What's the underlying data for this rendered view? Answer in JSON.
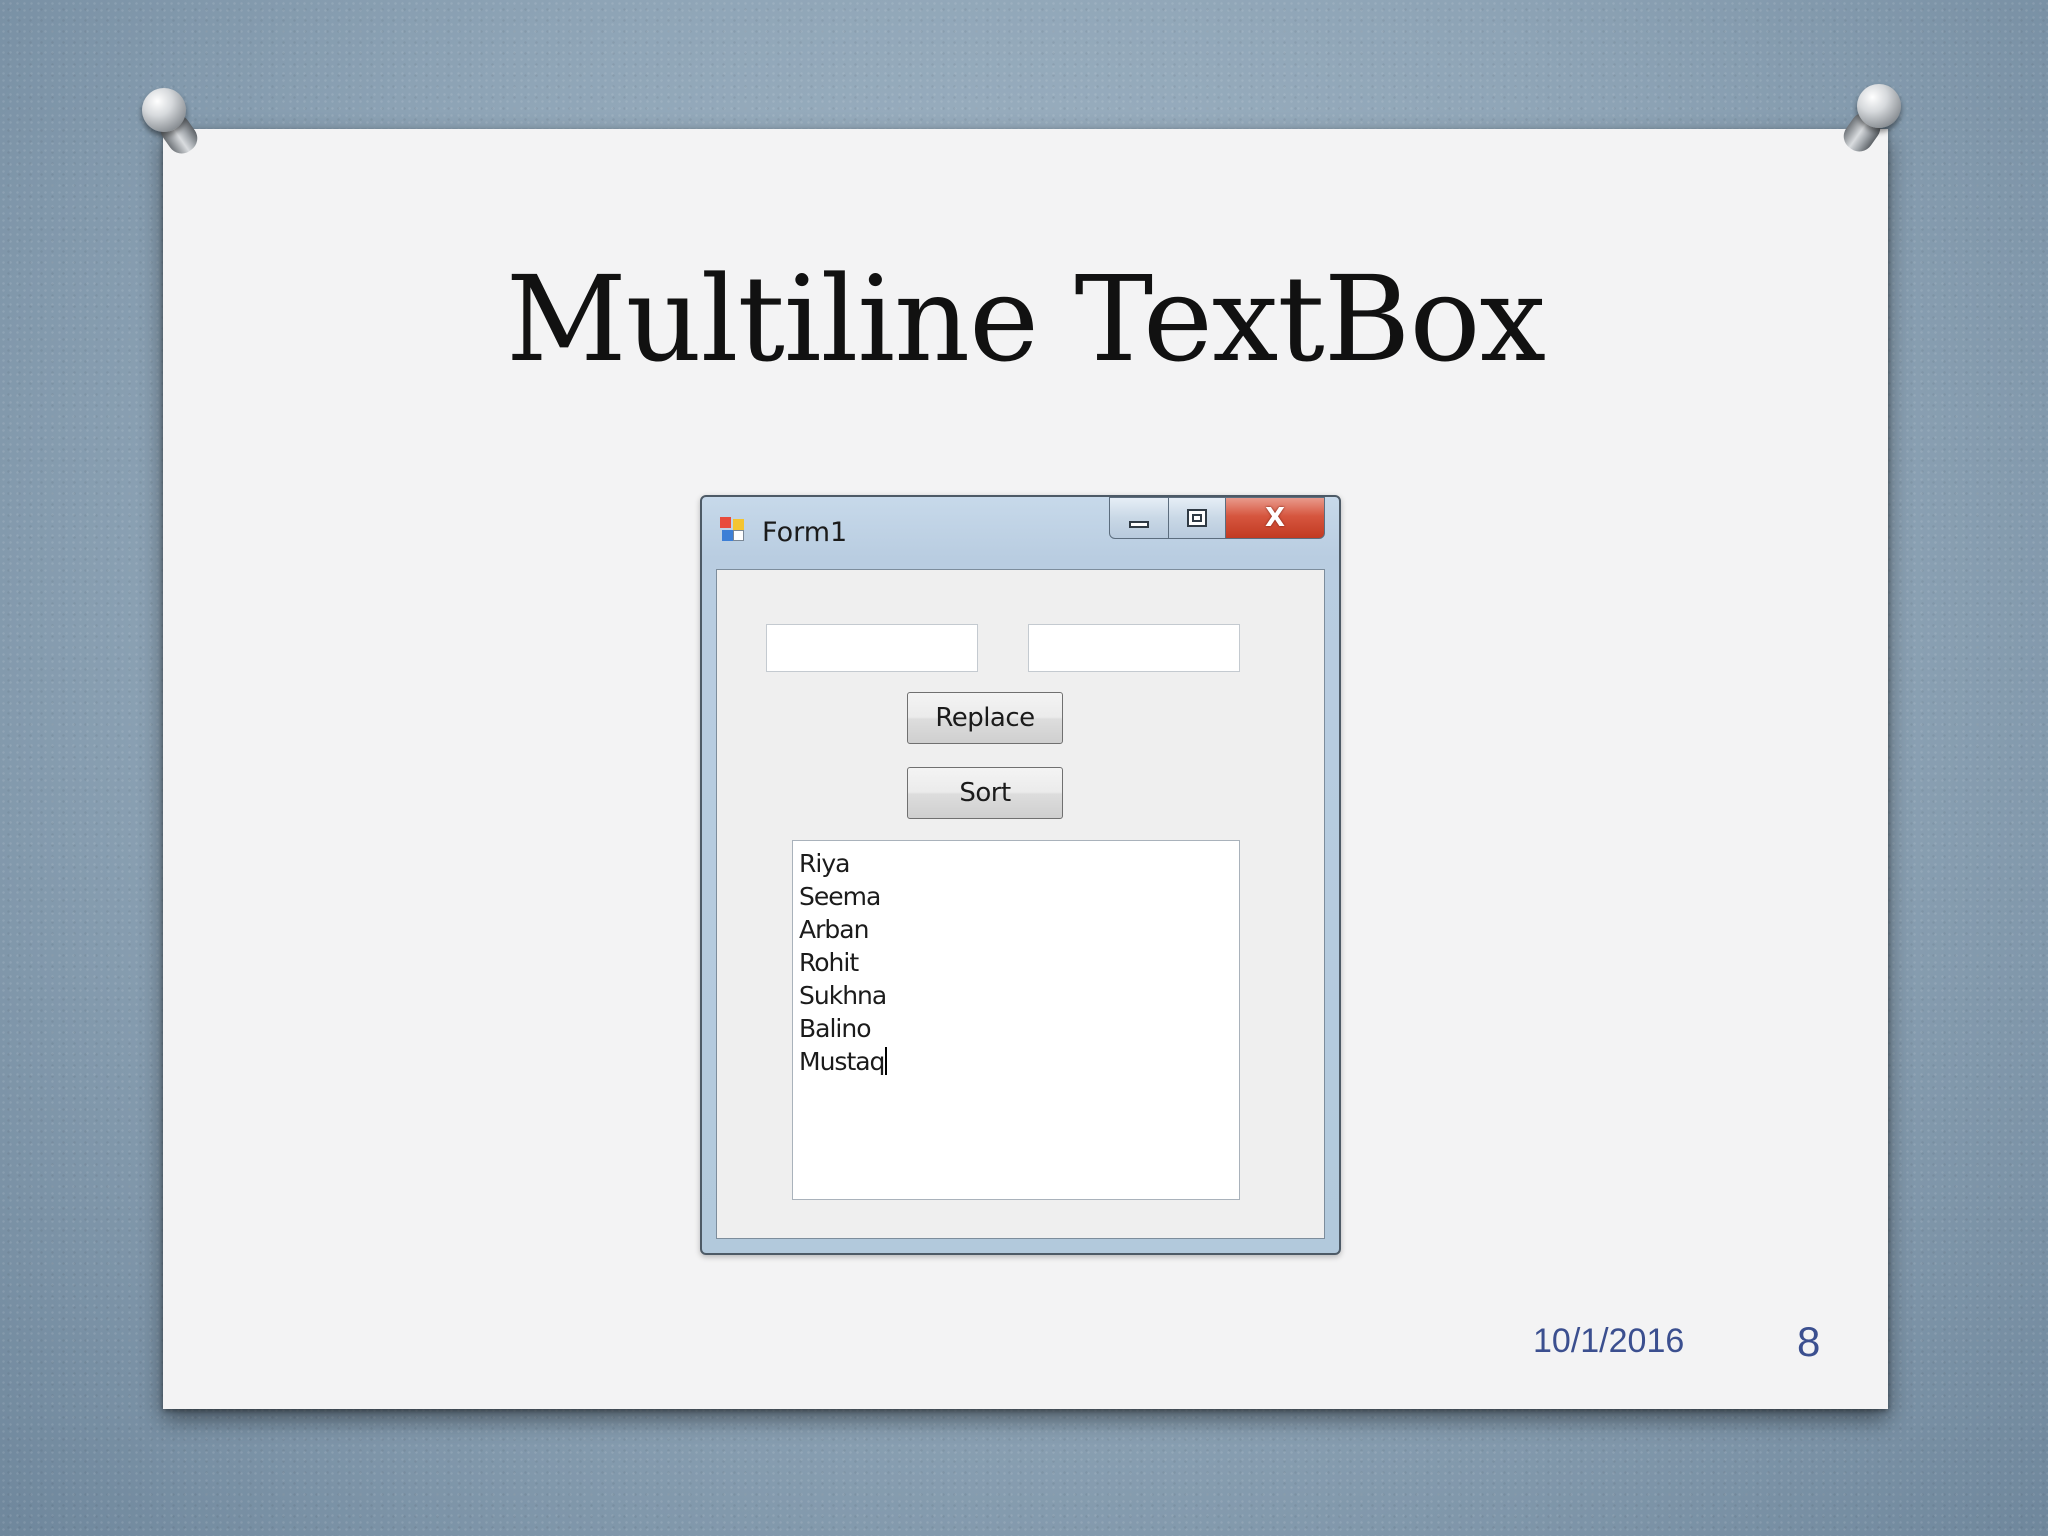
{
  "slide": {
    "title": "Multiline TextBox",
    "date": "10/1/2016",
    "page_number": "8"
  },
  "window": {
    "title": "Form1",
    "icon": "winforms-app-icon",
    "caption_buttons": {
      "minimize_icon": "minimize-icon",
      "maximize_icon": "maximize-icon",
      "close_glyph": "X"
    }
  },
  "form": {
    "textbox1": {
      "value": ""
    },
    "textbox2": {
      "value": ""
    },
    "replace_button": "Replace",
    "sort_button": "Sort",
    "multiline_lines": [
      "Riya",
      "Seema",
      "Arban",
      "Rohit",
      "Sukhna",
      "Balino",
      "Mustaq"
    ]
  },
  "colors": {
    "footer_text": "#3b4f8f",
    "close_button": "#c23a22",
    "background": "#8ea4b6"
  }
}
